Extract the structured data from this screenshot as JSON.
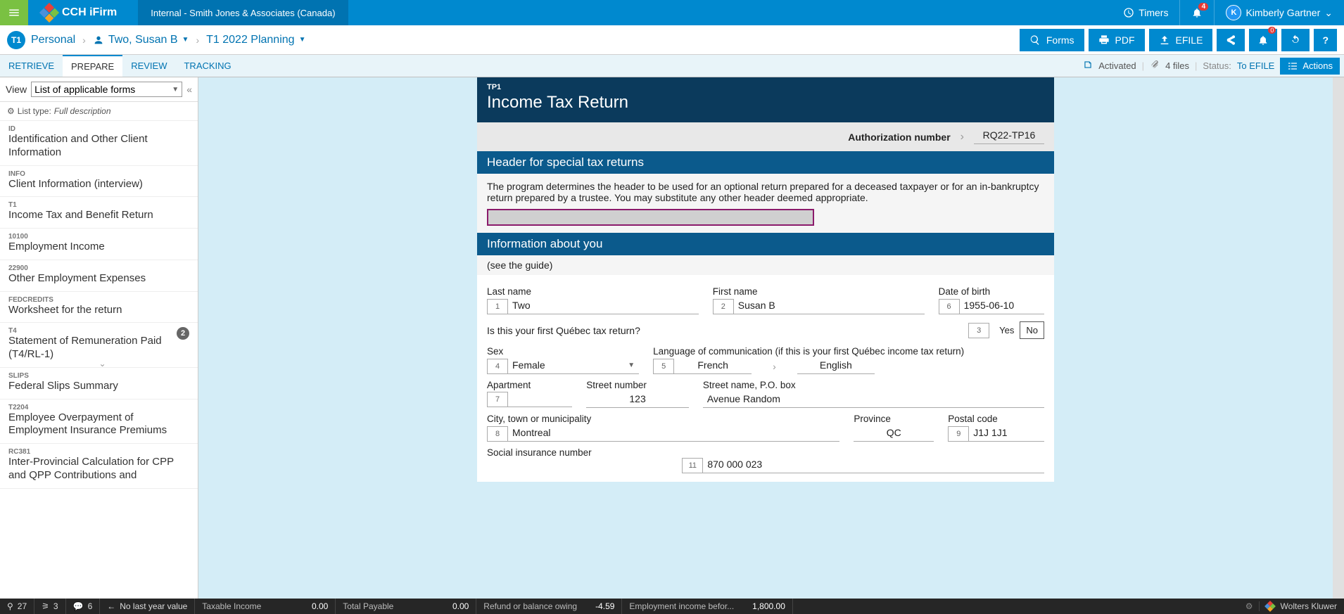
{
  "topbar": {
    "product": "CCH iFirm",
    "org": "Internal - Smith Jones & Associates (Canada)",
    "timers": "Timers",
    "notif_count": "4",
    "user_initial": "K",
    "user_name": "Kimberly Gartner"
  },
  "context": {
    "badge": "T1",
    "module": "Personal",
    "client": "Two, Susan B",
    "plan": "T1 2022 Planning",
    "btn_forms": "Forms",
    "btn_pdf": "PDF",
    "btn_efile": "EFILE",
    "alert_count": "0"
  },
  "tabs": {
    "retrieve": "RETRIEVE",
    "prepare": "PREPARE",
    "review": "REVIEW",
    "tracking": "TRACKING",
    "activated": "Activated",
    "files": "4 files",
    "status_label": "Status:",
    "status_value": "To EFILE",
    "actions": "Actions"
  },
  "sidebar": {
    "view_label": "View",
    "view_value": "List of applicable forms",
    "listtype_prefix": "List type:",
    "listtype_value": "Full description",
    "items": [
      {
        "code": "ID",
        "name": "Identification and Other Client Information"
      },
      {
        "code": "INFO",
        "name": "Client Information (interview)"
      },
      {
        "code": "T1",
        "name": "Income Tax and Benefit Return"
      },
      {
        "code": "10100",
        "name": "Employment Income"
      },
      {
        "code": "22900",
        "name": "Other Employment Expenses"
      },
      {
        "code": "FEDCREDITS",
        "name": "Worksheet for the return"
      },
      {
        "code": "T4",
        "name": "Statement of Remuneration Paid (T4/RL-1)",
        "badge": "2"
      },
      {
        "code": "SLIPS",
        "name": "Federal Slips Summary"
      },
      {
        "code": "T2204",
        "name": "Employee Overpayment of Employment Insurance Premiums"
      },
      {
        "code": "RC381",
        "name": "Inter-Provincial Calculation for CPP and QPP Contributions and"
      }
    ]
  },
  "form": {
    "code": "TP1",
    "title": "Income Tax Return",
    "auth_label": "Authorization number",
    "auth_value": "RQ22-TP16",
    "section_header": "Header for special tax returns",
    "header_desc": "The program determines the header to be used for an optional return prepared for a deceased taxpayer or for an in-bankruptcy return prepared by a trustee. You may substitute any other header deemed appropriate.",
    "section_info": "Information about you",
    "see_guide": "(see the guide)",
    "lbl_last": "Last name",
    "lbl_first": "First name",
    "lbl_dob": "Date of birth",
    "last_name": "Two",
    "first_name": "Susan B",
    "dob": "1955-06-10",
    "q_first_qc": "Is this your first Québec tax return?",
    "yes": "Yes",
    "no": "No",
    "lbl_sex": "Sex",
    "lbl_lang": "Language of communication (if this is your first Québec income tax return)",
    "sex": "Female",
    "lang1": "French",
    "lang2": "English",
    "lbl_apt": "Apartment",
    "lbl_streetno": "Street number",
    "lbl_streetname": "Street name, P.O. box",
    "apt": "",
    "streetno": "123",
    "streetname": "Avenue Random",
    "lbl_city": "City, town or municipality",
    "lbl_prov": "Province",
    "lbl_postal": "Postal code",
    "city": "Montreal",
    "prov": "QC",
    "postal": "J1J 1J1",
    "lbl_sin": "Social insurance number",
    "sin": "870 000 023",
    "n1": "1",
    "n2": "2",
    "n3": "3",
    "n4": "4",
    "n5": "5",
    "n6": "6",
    "n7": "7",
    "n8": "8",
    "n9": "9",
    "n11": "11"
  },
  "footer": {
    "pin_count": "27",
    "tree_count": "3",
    "msg_count": "6",
    "lastyear": "No last year value",
    "taxable_label": "Taxable Income",
    "taxable_value": "0.00",
    "payable_label": "Total Payable",
    "payable_value": "0.00",
    "refund_label": "Refund or balance owing",
    "refund_value": "-4.59",
    "emp_label": "Employment income befor...",
    "emp_value": "1,800.00",
    "wk": "Wolters Kluwer"
  }
}
